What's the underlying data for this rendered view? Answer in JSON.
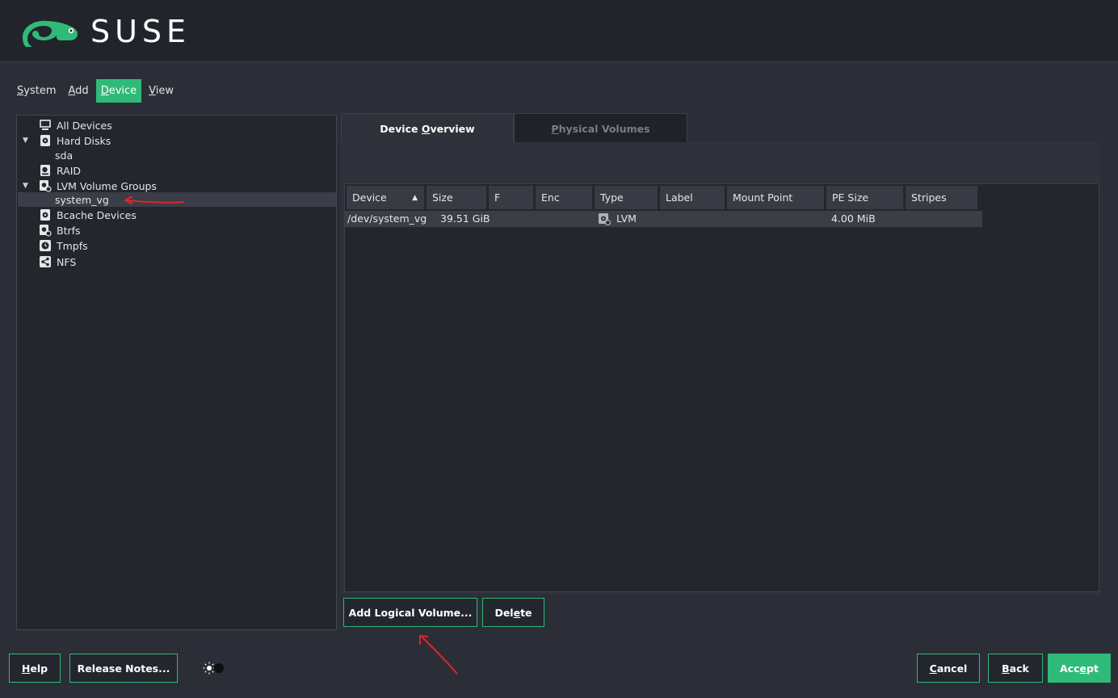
{
  "app": {
    "brand": "SUSE",
    "accent_color": "#30ba78"
  },
  "menu": {
    "items": [
      {
        "label": "System",
        "u": "S",
        "rest": "ystem",
        "active": false
      },
      {
        "label": "Add",
        "u": "A",
        "rest": "dd",
        "active": false
      },
      {
        "label": "Device",
        "u": "D",
        "rest": "evice",
        "active": true
      },
      {
        "label": "View",
        "u": "V",
        "rest": "iew",
        "active": false
      }
    ]
  },
  "tree": {
    "items": [
      {
        "label": "All Devices",
        "icon": "monitor-icon",
        "expanded": null,
        "selected": false
      },
      {
        "label": "Hard Disks",
        "icon": "hard-disk-icon",
        "expanded": true,
        "selected": false
      },
      {
        "label": "sda",
        "icon": null,
        "child": true,
        "selected": false
      },
      {
        "label": "RAID",
        "icon": "raid-icon",
        "expanded": null,
        "selected": false
      },
      {
        "label": "LVM Volume Groups",
        "icon": "lvm-icon",
        "expanded": true,
        "selected": false
      },
      {
        "label": "system_vg",
        "icon": null,
        "child": true,
        "selected": true
      },
      {
        "label": "Bcache Devices",
        "icon": "bcache-icon",
        "expanded": null,
        "selected": false
      },
      {
        "label": "Btrfs",
        "icon": "btrfs-icon",
        "expanded": null,
        "selected": false
      },
      {
        "label": "Tmpfs",
        "icon": "tmpfs-icon",
        "expanded": null,
        "selected": false
      },
      {
        "label": "NFS",
        "icon": "nfs-icon",
        "expanded": null,
        "selected": false
      }
    ]
  },
  "tabs": {
    "overview": {
      "pre": "Device ",
      "u": "O",
      "post": "verview"
    },
    "pvs": {
      "pre": "",
      "u": "P",
      "post": "hysical Volumes"
    }
  },
  "table": {
    "columns": [
      "Device",
      "Size",
      "F",
      "Enc",
      "Type",
      "Label",
      "Mount Point",
      "PE Size",
      "Stripes"
    ],
    "sort_column": "Device",
    "sort_direction": "ascending",
    "rows": [
      {
        "device": "/dev/system_vg",
        "size": "39.51 GiB",
        "f": "",
        "enc": "",
        "type": "LVM",
        "type_icon": "lvm-icon",
        "label": "",
        "mount_point": "",
        "pe_size": "4.00 MiB",
        "stripes": ""
      }
    ]
  },
  "actions": {
    "add_lv": "Add Logical Volume...",
    "delete": {
      "pre": "Del",
      "u": "e",
      "post": "te"
    }
  },
  "footer": {
    "help": {
      "u": "H",
      "post": "elp"
    },
    "release_notes": "Release Notes...",
    "cancel": {
      "u": "C",
      "post": "ancel"
    },
    "back": {
      "u": "B",
      "post": "ack"
    },
    "accept": {
      "pre": "Acc",
      "u": "e",
      "post": "pt"
    }
  }
}
